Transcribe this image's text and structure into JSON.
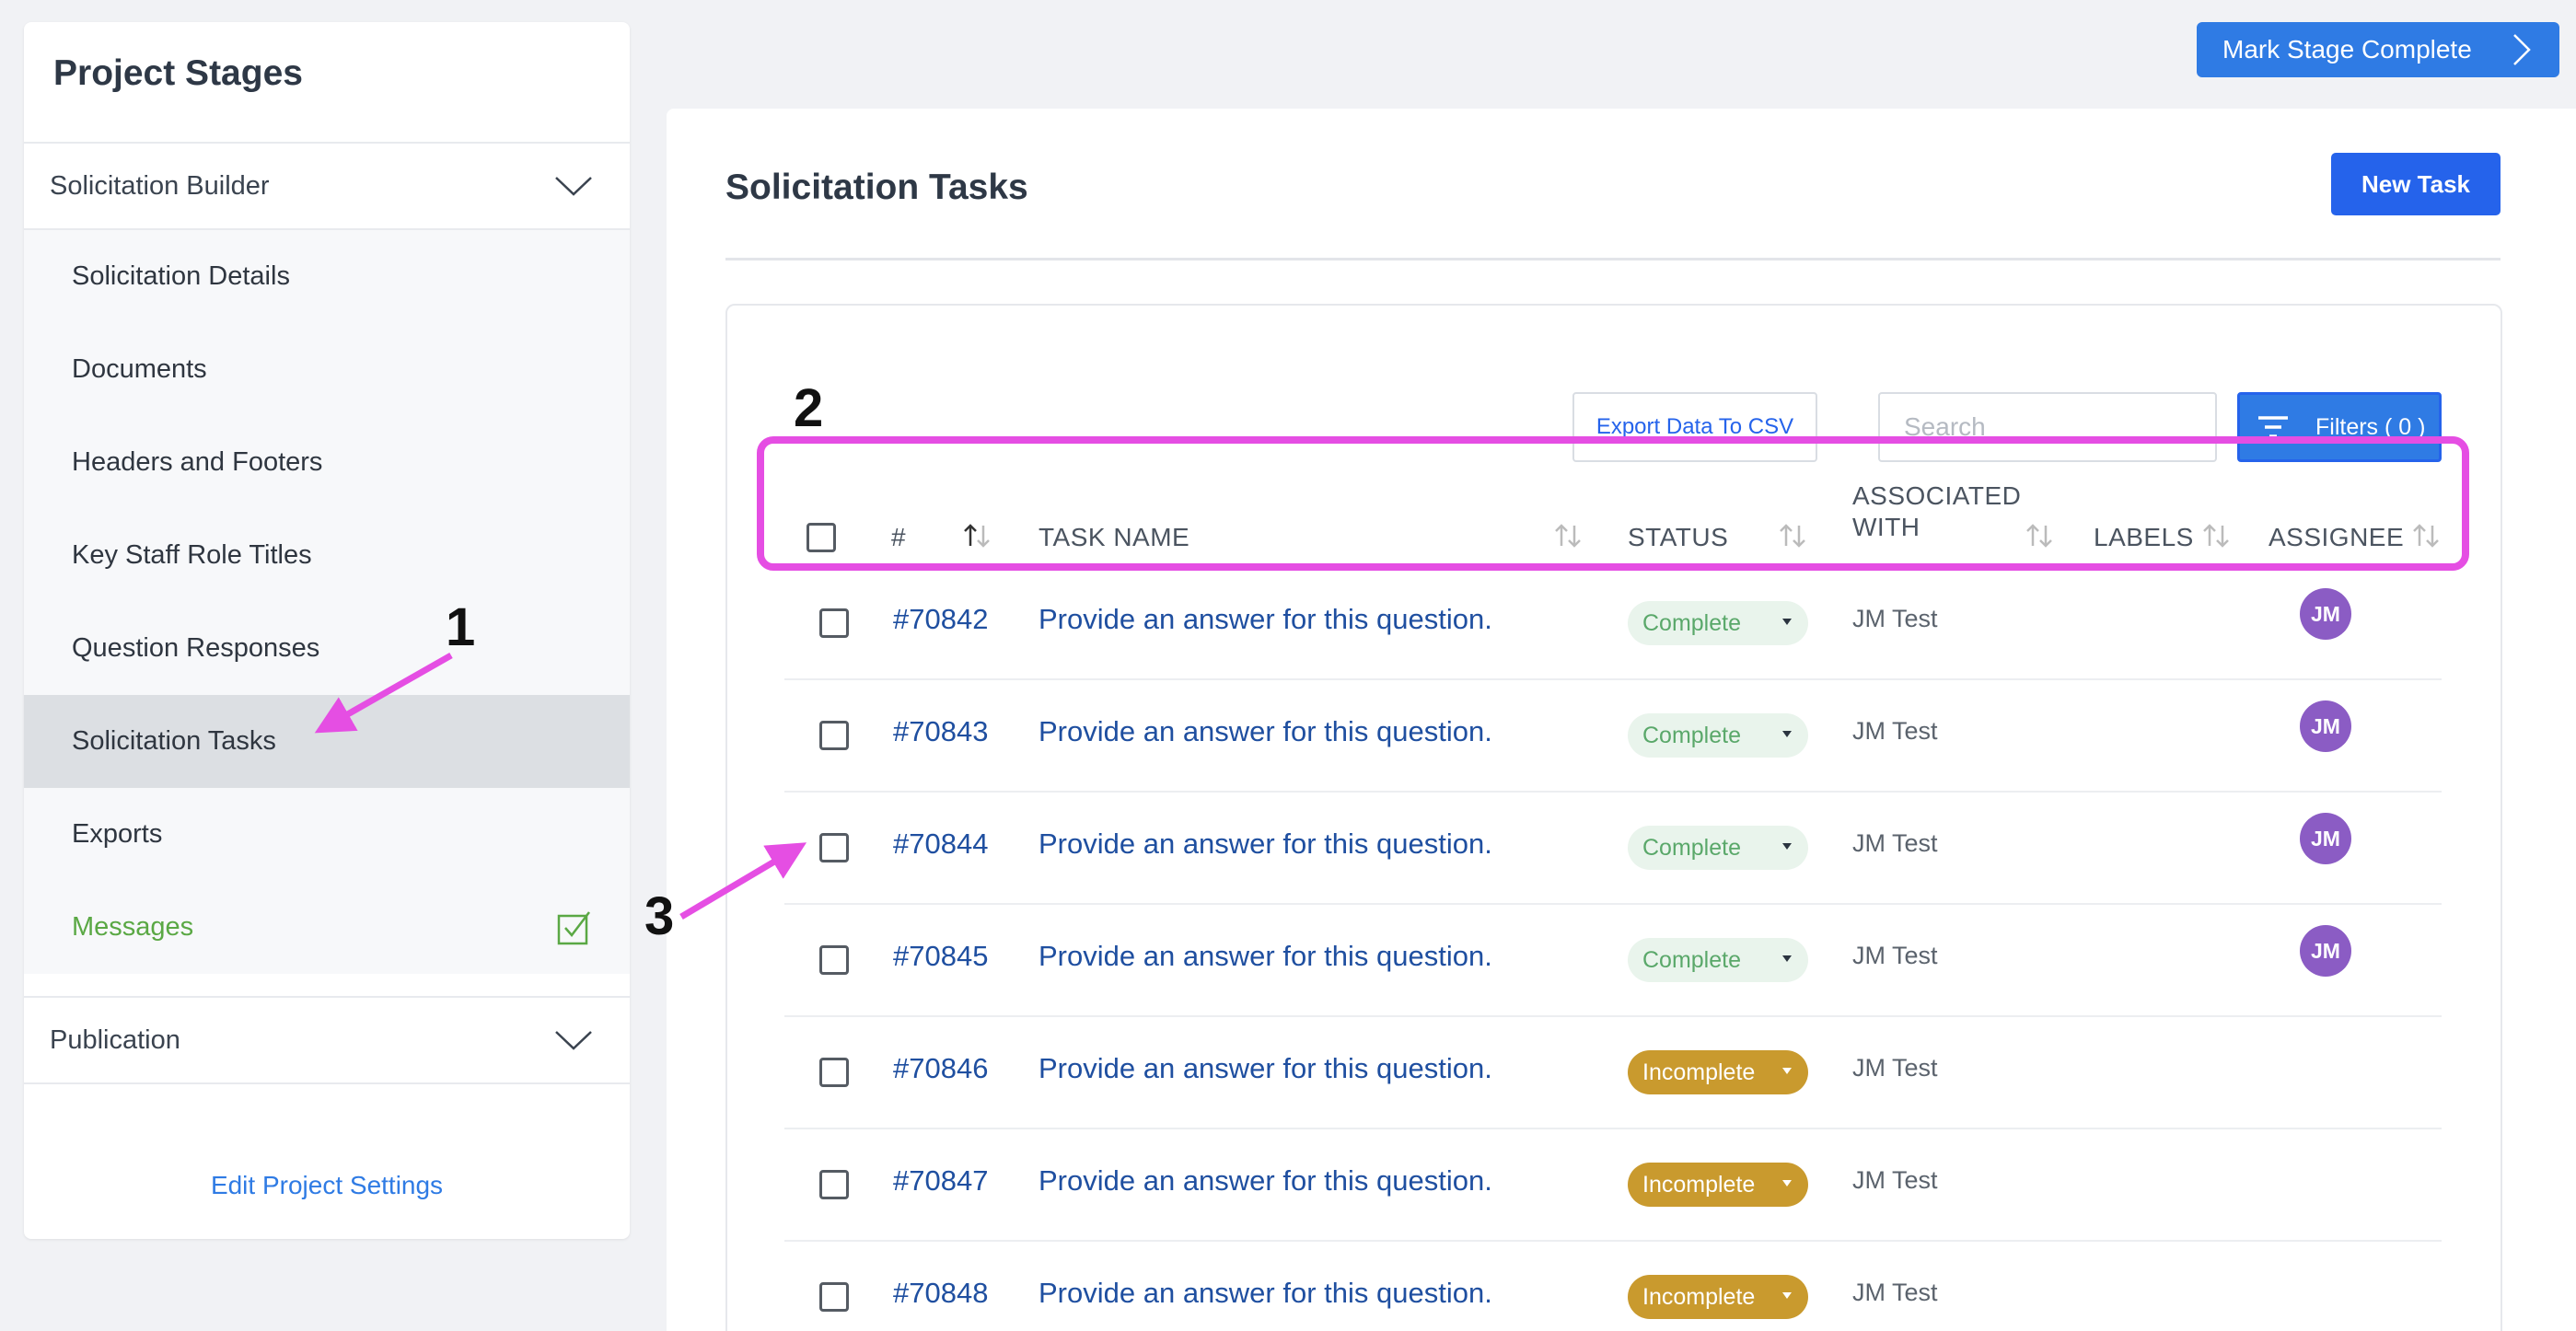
{
  "sidebar": {
    "title": "Project Stages",
    "stage1": "Solicitation Builder",
    "items": [
      {
        "label": "Solicitation Details"
      },
      {
        "label": "Documents"
      },
      {
        "label": "Headers and Footers"
      },
      {
        "label": "Key Staff Role Titles"
      },
      {
        "label": "Question Responses"
      },
      {
        "label": "Solicitation Tasks"
      },
      {
        "label": "Exports"
      },
      {
        "label": "Messages"
      }
    ],
    "stage2": "Publication",
    "edit_settings": "Edit Project Settings"
  },
  "top": {
    "mark_complete": "Mark Stage Complete"
  },
  "main": {
    "title": "Solicitation Tasks",
    "new_task": "New Task",
    "export": "Export Data To CSV",
    "search_placeholder": "Search",
    "filters": "Filters ( 0 )"
  },
  "table": {
    "headers": {
      "num": "#",
      "task_name": "TASK NAME",
      "status": "STATUS",
      "assoc_line1": "ASSOCIATED",
      "assoc_line2": "WITH",
      "labels": "LABELS",
      "assignee": "ASSIGNEE"
    },
    "rows": [
      {
        "id": "#70842",
        "name": "Provide an answer for this question.",
        "status": "Complete",
        "assoc": "JM Test",
        "assignee": "JM"
      },
      {
        "id": "#70843",
        "name": "Provide an answer for this question.",
        "status": "Complete",
        "assoc": "JM Test",
        "assignee": "JM"
      },
      {
        "id": "#70844",
        "name": "Provide an answer for this question.",
        "status": "Complete",
        "assoc": "JM Test",
        "assignee": "JM"
      },
      {
        "id": "#70845",
        "name": "Provide an answer for this question.",
        "status": "Complete",
        "assoc": "JM Test",
        "assignee": "JM"
      },
      {
        "id": "#70846",
        "name": "Provide an answer for this question.",
        "status": "Incomplete",
        "assoc": "JM Test",
        "assignee": ""
      },
      {
        "id": "#70847",
        "name": "Provide an answer for this question.",
        "status": "Incomplete",
        "assoc": "JM Test",
        "assignee": ""
      },
      {
        "id": "#70848",
        "name": "Provide an answer for this question.",
        "status": "Incomplete",
        "assoc": "JM Test",
        "assignee": ""
      }
    ]
  },
  "annotations": {
    "a1": "1",
    "a2": "2",
    "a3": "3"
  },
  "colors": {
    "accent": "#2f7be4",
    "annotation": "#e54ee3",
    "complete_bg": "#e9f4ec",
    "incomplete_bg": "#c99a2e",
    "avatar": "#8b5cc4"
  }
}
